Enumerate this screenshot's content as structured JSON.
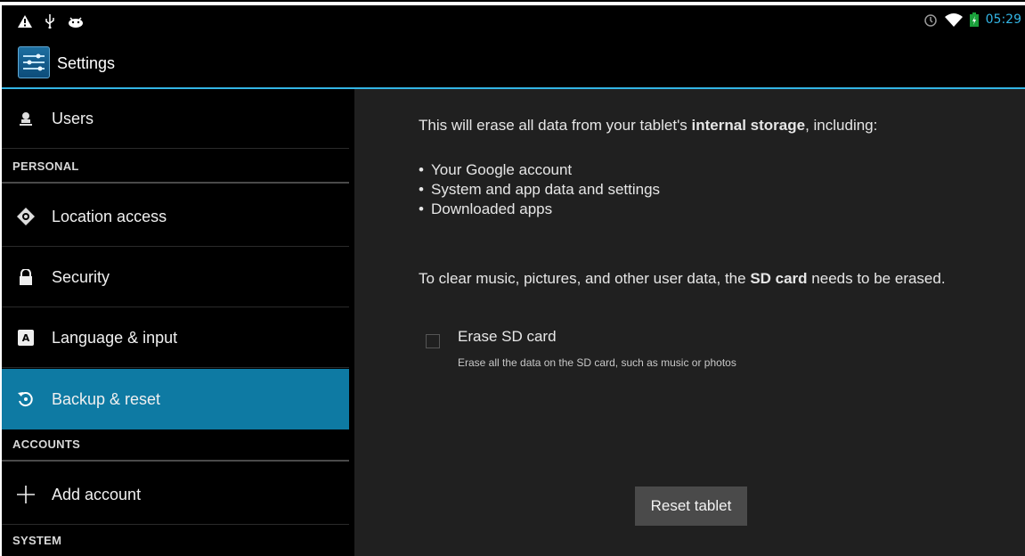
{
  "status_bar": {
    "left_icons": [
      "warning-icon",
      "usb-icon",
      "android-debug-icon"
    ],
    "right_icons": [
      "alarm-icon",
      "wifi-icon",
      "battery-icon"
    ],
    "time": "05:29",
    "accent_color": "#33b5e5"
  },
  "action_bar": {
    "icon": "settings-sliders-icon",
    "title": "Settings"
  },
  "sidebar": {
    "users_label": "Users",
    "personal_header": "PERSONAL",
    "location_label": "Location access",
    "security_label": "Security",
    "language_label": "Language & input",
    "backup_label": "Backup & reset",
    "accounts_header": "ACCOUNTS",
    "add_account_label": "Add account",
    "system_header": "SYSTEM",
    "active_color": "#0e7aa3"
  },
  "content": {
    "intro_prefix": "This will erase all data from your tablet's ",
    "intro_bold": "internal storage",
    "intro_suffix": ", including:",
    "bullets": [
      "Your Google account",
      "System and app data and settings",
      "Downloaded apps"
    ],
    "sd_prefix": "To clear music, pictures, and other user data, the ",
    "sd_bold": "SD card",
    "sd_suffix": " needs to be erased.",
    "erase_sd_title": "Erase SD card",
    "erase_sd_subtitle": "Erase all the data on the SD card, such as music or photos",
    "erase_sd_checked": false,
    "reset_button": "Reset tablet"
  }
}
